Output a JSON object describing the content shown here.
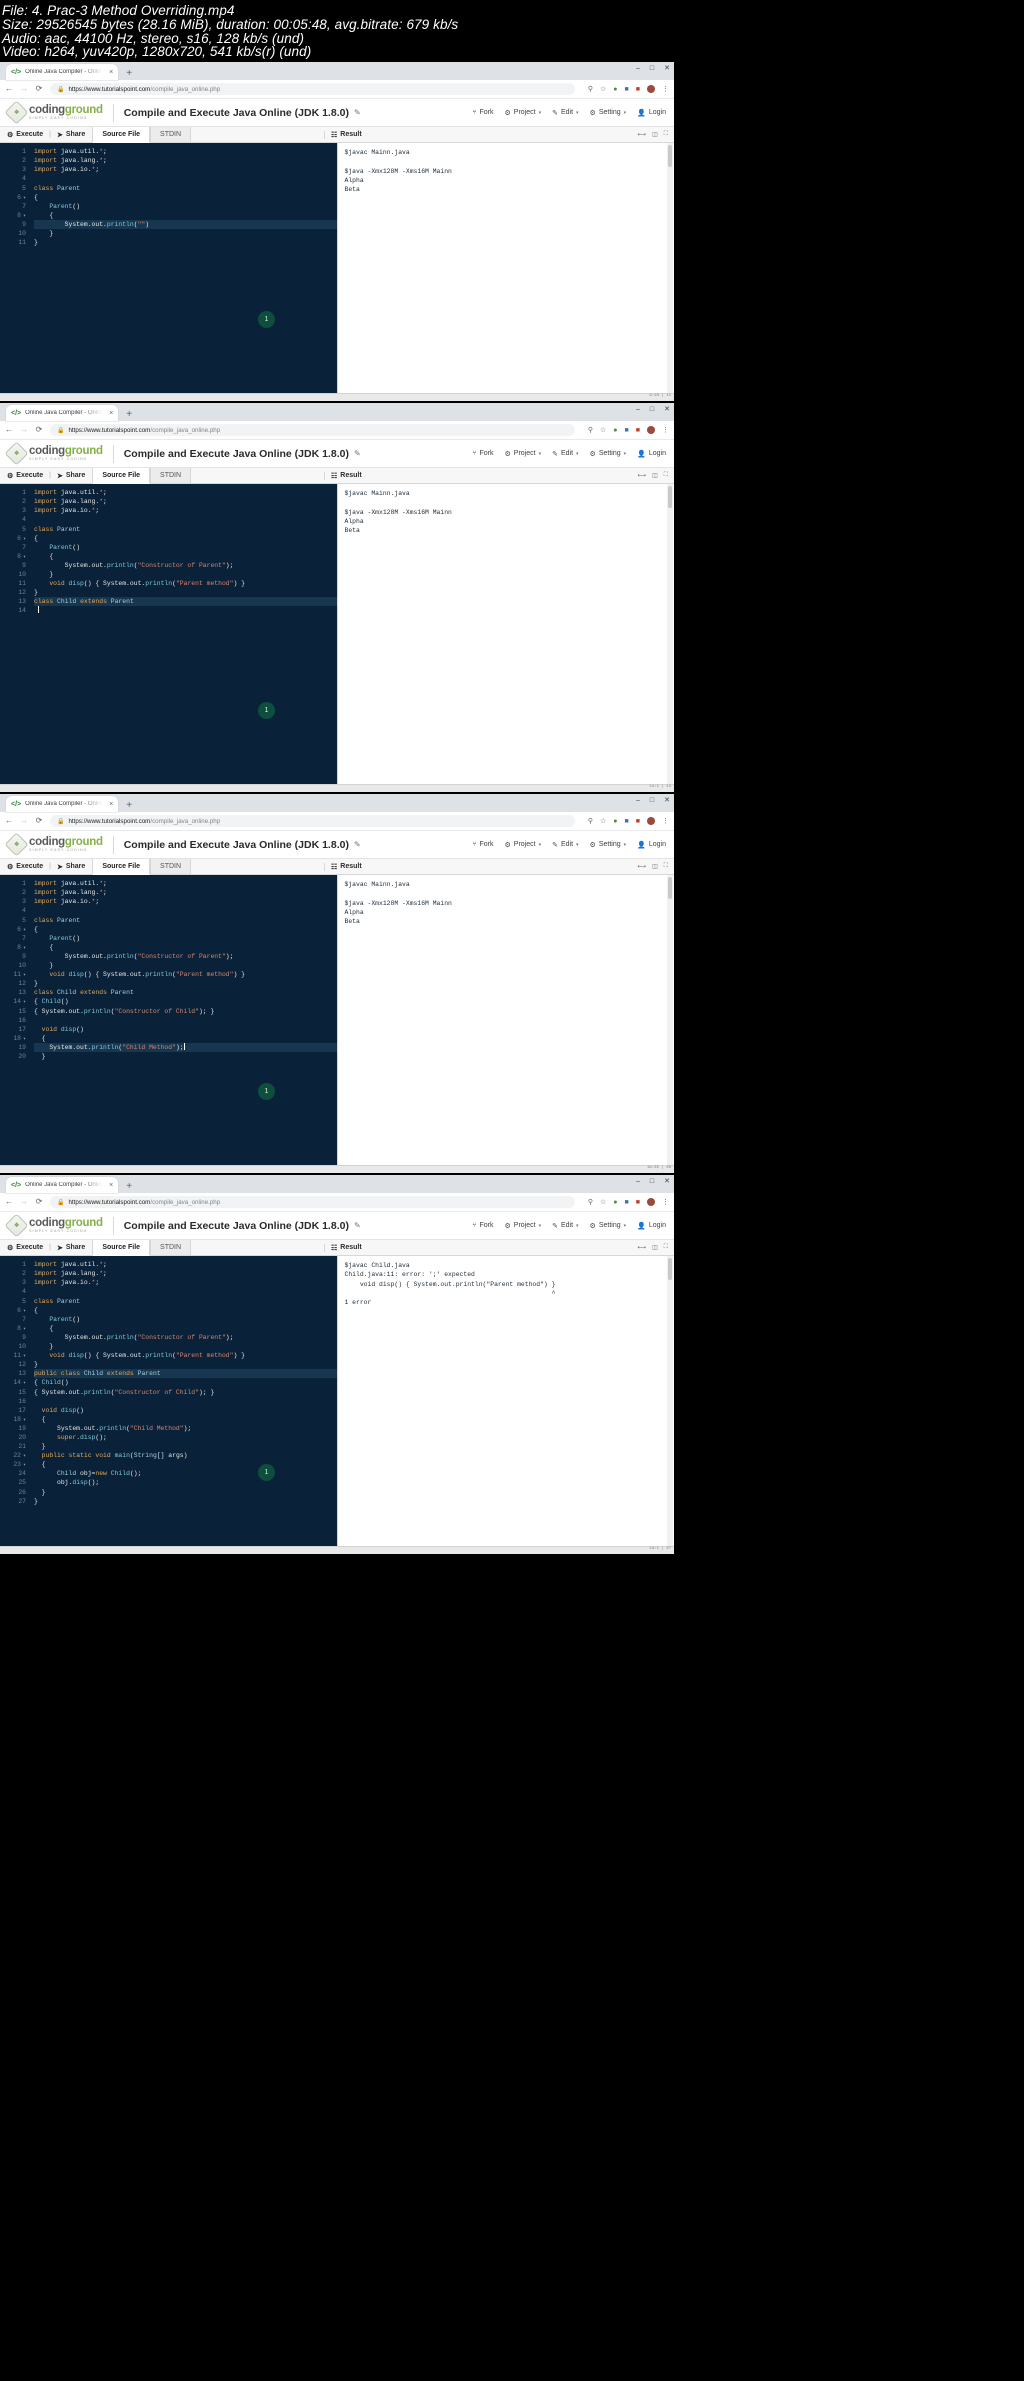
{
  "video_meta": {
    "lines": [
      "File: 4. Prac-3 Method Overriding.mp4",
      "Size: 29526545 bytes (28.16 MiB), duration: 00:05:48, avg.bitrate: 679 kb/s",
      "Audio: aac, 44100 Hz, stereo, s16, 128 kb/s (und)",
      "Video: h264, yuv420p, 1280x720, 541 kb/s(r) (und)"
    ]
  },
  "browser": {
    "tab_title": "Online Java Compiler - Online Ja",
    "tab_close": "×",
    "new_tab": "+",
    "window_controls": {
      "minimize": "–",
      "maximize": "□",
      "close": "✕"
    },
    "nav": {
      "back": "←",
      "forward": "→",
      "reload": "⟳"
    },
    "lock_icon": "🔒",
    "url_host": "https://www.tutorialspoint.com",
    "url_path": "/compile_java_online.php",
    "omnibox_icons": [
      "search-icon",
      "bookmark-star-icon",
      "extension-green-icon",
      "extension-blue-icon",
      "extension-red-icon",
      "menu-icon"
    ],
    "menu_glyph": "⋮"
  },
  "page_header": {
    "logo_word_1": "coding",
    "logo_word_2": "ground",
    "logo_tagline": "SIMPLY EASY CODING",
    "title": "Compile and Execute Java Online (JDK 1.8.0)",
    "edit_icon": "✐",
    "menu": [
      {
        "label": "Fork",
        "icon": "fork-icon",
        "caret": ""
      },
      {
        "label": "Project",
        "icon": "project-icon",
        "caret": "▾"
      },
      {
        "label": "Edit",
        "icon": "edit-icon",
        "caret": "▾"
      },
      {
        "label": "Setting",
        "icon": "gear-icon",
        "caret": "▾"
      },
      {
        "label": "Login",
        "icon": "user-icon",
        "caret": ""
      }
    ]
  },
  "toolbar": {
    "execute_label": "Execute",
    "execute_icon": "⚙",
    "divider": "|",
    "share_label": "Share",
    "share_icon": "➤",
    "tabs": [
      {
        "label": "Source File",
        "active": true
      },
      {
        "label": "STDIN",
        "active": false
      }
    ],
    "result_label": "Result",
    "result_icon": "‖",
    "window_icons": [
      "collapse-icon",
      "expand-icon",
      "fullscreen-icon"
    ]
  },
  "panels": [
    {
      "id": "panel-1",
      "badge": "1",
      "line_count": 11,
      "code_lines": [
        {
          "n": 1,
          "fold": false,
          "html": "<span class='kw'>import</span> java.util.<span class='str'>*</span>;"
        },
        {
          "n": 2,
          "fold": false,
          "html": "<span class='kw'>import</span> java.lang.<span class='str'>*</span>;"
        },
        {
          "n": 3,
          "fold": false,
          "html": "<span class='kw'>import</span> java.io.<span class='str'>*</span>;"
        },
        {
          "n": 4,
          "fold": false,
          "html": ""
        },
        {
          "n": 5,
          "fold": false,
          "html": "<span class='kw'>class</span> <span class='typ'>Parent</span>"
        },
        {
          "n": 6,
          "fold": true,
          "html": "{"
        },
        {
          "n": 7,
          "fold": false,
          "html": "    <span class='fn'>Parent</span>()"
        },
        {
          "n": 8,
          "fold": true,
          "html": "    {"
        },
        {
          "n": 9,
          "fold": false,
          "html": "        System.out.<span class='fn'>println</span>(<span class='str'>\"\"</span>)",
          "highlight": true
        },
        {
          "n": 10,
          "fold": false,
          "html": "    }"
        },
        {
          "n": 11,
          "fold": false,
          "html": "}"
        }
      ],
      "result_lines": [
        "$javac Mainn.java",
        "",
        "$java -Xmx128M -Xms16M Mainn",
        "Alpha",
        "Beta"
      ],
      "status_right": "9:23 | 11"
    },
    {
      "id": "panel-2",
      "badge": "1",
      "line_count": 14,
      "code_lines": [
        {
          "n": 1,
          "fold": false,
          "html": "<span class='kw'>import</span> java.util.<span class='str'>*</span>;"
        },
        {
          "n": 2,
          "fold": false,
          "html": "<span class='kw'>import</span> java.lang.<span class='str'>*</span>;"
        },
        {
          "n": 3,
          "fold": false,
          "html": "<span class='kw'>import</span> java.io.<span class='str'>*</span>;"
        },
        {
          "n": 4,
          "fold": false,
          "html": ""
        },
        {
          "n": 5,
          "fold": false,
          "html": "<span class='kw'>class</span> <span class='typ'>Parent</span>"
        },
        {
          "n": 6,
          "fold": true,
          "html": "{"
        },
        {
          "n": 7,
          "fold": false,
          "html": "    <span class='fn'>Parent</span>()"
        },
        {
          "n": 8,
          "fold": true,
          "html": "    {"
        },
        {
          "n": 9,
          "fold": false,
          "html": "        System.out.<span class='fn'>println</span>(<span class='str'>\"Constructor of Parent\"</span>);"
        },
        {
          "n": 10,
          "fold": false,
          "html": "    }"
        },
        {
          "n": 11,
          "fold": false,
          "html": "    <span class='kw'>void</span> <span class='fn'>disp</span>() { System.out.<span class='fn'>println</span>(<span class='str'>\"Parent method\"</span>) }"
        },
        {
          "n": 12,
          "fold": false,
          "html": "}"
        },
        {
          "n": 13,
          "fold": false,
          "html": "<span class='kw'>class</span> <span class='typ'>Child</span> <span class='kw'>extends</span> <span class='typ'>Parent</span>",
          "highlight": true
        },
        {
          "n": 14,
          "fold": false,
          "html": "",
          "caret": true
        }
      ],
      "result_lines": [
        "$javac Mainn.java",
        "",
        "$java -Xmx128M -Xms16M Mainn",
        "Alpha",
        "Beta"
      ],
      "status_right": "14:1 | 14"
    },
    {
      "id": "panel-3",
      "badge": "1",
      "line_count": 20,
      "code_lines": [
        {
          "n": 1,
          "fold": false,
          "html": "<span class='kw'>import</span> java.util.<span class='str'>*</span>;"
        },
        {
          "n": 2,
          "fold": false,
          "html": "<span class='kw'>import</span> java.lang.<span class='str'>*</span>;"
        },
        {
          "n": 3,
          "fold": false,
          "html": "<span class='kw'>import</span> java.io.<span class='str'>*</span>;"
        },
        {
          "n": 4,
          "fold": false,
          "html": ""
        },
        {
          "n": 5,
          "fold": false,
          "html": "<span class='kw'>class</span> <span class='typ'>Parent</span>"
        },
        {
          "n": 6,
          "fold": true,
          "html": "{"
        },
        {
          "n": 7,
          "fold": false,
          "html": "    <span class='fn'>Parent</span>()"
        },
        {
          "n": 8,
          "fold": true,
          "html": "    {"
        },
        {
          "n": 9,
          "fold": false,
          "html": "        System.out.<span class='fn'>println</span>(<span class='str'>\"Constructor of Parent\"</span>);"
        },
        {
          "n": 10,
          "fold": false,
          "html": "    }"
        },
        {
          "n": 11,
          "fold": true,
          "html": "    <span class='kw'>void</span> <span class='fn'>disp</span>() { System.out.<span class='fn'>println</span>(<span class='str'>\"Parent method\"</span>) }"
        },
        {
          "n": 12,
          "fold": false,
          "html": "}"
        },
        {
          "n": 13,
          "fold": false,
          "html": "<span class='kw'>class</span> <span class='typ'>Child</span> <span class='kw'>extends</span> <span class='typ'>Parent</span>"
        },
        {
          "n": 14,
          "fold": true,
          "html": "{ <span class='fn'>Child</span>()"
        },
        {
          "n": 15,
          "fold": false,
          "html": "{ System.out.<span class='fn'>println</span>(<span class='str'>\"Constructor of Child\"</span>); }"
        },
        {
          "n": 16,
          "fold": false,
          "html": ""
        },
        {
          "n": 17,
          "fold": false,
          "html": "  <span class='kw'>void</span> <span class='fn'>disp</span>()"
        },
        {
          "n": 18,
          "fold": true,
          "html": "  {"
        },
        {
          "n": 19,
          "fold": false,
          "html": "    System.out.<span class='fn'>println</span>(<span class='str'>\"Child Method\"</span>);",
          "highlight": true,
          "caret": true
        },
        {
          "n": 20,
          "fold": false,
          "html": "  }"
        }
      ],
      "result_lines": [
        "$javac Mainn.java",
        "",
        "$java -Xmx128M -Xms16M Mainn",
        "Alpha",
        "Beta"
      ],
      "status_right": "19:35 | 20"
    },
    {
      "id": "panel-4",
      "badge": "1",
      "line_count": 27,
      "code_lines": [
        {
          "n": 1,
          "fold": false,
          "html": "<span class='kw'>import</span> java.util.<span class='str'>*</span>;"
        },
        {
          "n": 2,
          "fold": false,
          "html": "<span class='kw'>import</span> java.lang.<span class='str'>*</span>;"
        },
        {
          "n": 3,
          "fold": false,
          "html": "<span class='kw'>import</span> java.io.<span class='str'>*</span>;"
        },
        {
          "n": 4,
          "fold": false,
          "html": ""
        },
        {
          "n": 5,
          "fold": false,
          "html": "<span class='kw'>class</span> <span class='typ'>Parent</span>"
        },
        {
          "n": 6,
          "fold": true,
          "html": "{"
        },
        {
          "n": 7,
          "fold": false,
          "html": "    <span class='fn'>Parent</span>()"
        },
        {
          "n": 8,
          "fold": true,
          "html": "    {"
        },
        {
          "n": 9,
          "fold": false,
          "html": "        System.out.<span class='fn'>println</span>(<span class='str'>\"Constructor of Parent\"</span>);"
        },
        {
          "n": 10,
          "fold": false,
          "html": "    }"
        },
        {
          "n": 11,
          "fold": true,
          "html": "    <span class='kw'>void</span> <span class='fn'>disp</span>() { System.out.<span class='fn'>println</span>(<span class='str'>\"Parent method\"</span>) }"
        },
        {
          "n": 12,
          "fold": false,
          "html": "}"
        },
        {
          "n": 13,
          "fold": false,
          "html": "<span class='kw'>public</span> <span class='kw'>class</span> <span class='typ'>Child</span> <span class='kw'>extends</span> <span class='typ'>Parent</span>",
          "highlight": true
        },
        {
          "n": 14,
          "fold": true,
          "html": "{ <span class='fn'>Child</span>()"
        },
        {
          "n": 15,
          "fold": false,
          "html": "{ System.out.<span class='fn'>println</span>(<span class='str'>\"Constructor of Child\"</span>); }"
        },
        {
          "n": 16,
          "fold": false,
          "html": ""
        },
        {
          "n": 17,
          "fold": false,
          "html": "  <span class='kw'>void</span> <span class='fn'>disp</span>()"
        },
        {
          "n": 18,
          "fold": true,
          "html": "  {"
        },
        {
          "n": 19,
          "fold": false,
          "html": "      System.out.<span class='fn'>println</span>(<span class='str'>\"Child Method\"</span>);"
        },
        {
          "n": 20,
          "fold": false,
          "html": "      <span class='kw'>super</span>.<span class='fn'>disp</span>();"
        },
        {
          "n": 21,
          "fold": false,
          "html": "  }"
        },
        {
          "n": 22,
          "fold": true,
          "html": "  <span class='kw'>public</span> <span class='kw'>static</span> <span class='kw'>void</span> <span class='fn'>main</span>(<span class='typ'>String</span>[] args)"
        },
        {
          "n": 23,
          "fold": true,
          "html": "  {"
        },
        {
          "n": 24,
          "fold": false,
          "html": "      <span class='typ'>Child</span> obj=<span class='kw'>new</span> <span class='fn'>Child</span>();"
        },
        {
          "n": 25,
          "fold": false,
          "html": "      obj.<span class='fn'>disp</span>();"
        },
        {
          "n": 26,
          "fold": false,
          "html": "  }"
        },
        {
          "n": 27,
          "fold": false,
          "html": "}"
        }
      ],
      "result_lines": [
        "$javac Child.java",
        "Child.java:11: error: ';' expected",
        "    void disp() { System.out.println(\"Parent method\") }",
        "                                                      ^",
        "1 error"
      ],
      "status_right": "13:1 | 27"
    }
  ]
}
